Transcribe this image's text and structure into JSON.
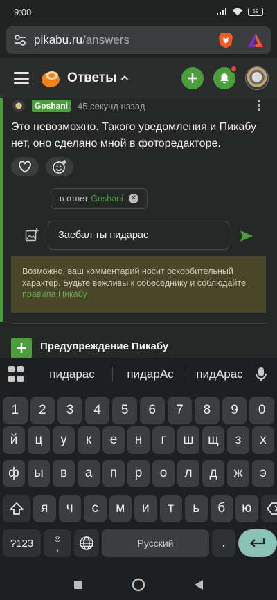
{
  "status_bar": {
    "time": "9:00",
    "battery": "59"
  },
  "browser": {
    "url_host": "pikabu.ru",
    "url_path": "/answers"
  },
  "app_header": {
    "title": "Ответы"
  },
  "comment": {
    "username": "Goshani",
    "time_ago": "45 секунд назад",
    "text": "Это невозможно. Такого уведомления и Пикабу нет, оно сделано мной в фоторедакторе."
  },
  "reply": {
    "reply_to_prefix": "в ответ",
    "reply_to_name": "Goshani",
    "input_value": "Заебал ты пидарас",
    "warning_text": "Возможно, ваш комментарий носит оскорбительный характер. Будьте вежливы к собеседнику и соблюдайте ",
    "warning_link": "правила Пикабу"
  },
  "section": {
    "title": "Предупреждение Пикабу"
  },
  "keyboard": {
    "suggestions": [
      "пидарас",
      "пидарАс",
      "пидАрас"
    ],
    "row_numbers": [
      "1",
      "2",
      "3",
      "4",
      "5",
      "6",
      "7",
      "8",
      "9",
      "0"
    ],
    "row1": [
      "й",
      "ц",
      "у",
      "к",
      "е",
      "н",
      "г",
      "ш",
      "щ",
      "з",
      "х"
    ],
    "row2": [
      "ф",
      "ы",
      "в",
      "а",
      "п",
      "р",
      "о",
      "л",
      "д",
      "ж",
      "э"
    ],
    "row3": [
      "я",
      "ч",
      "с",
      "м",
      "и",
      "т",
      "ь",
      "б",
      "ю"
    ],
    "symbols_key": "?123",
    "emoji_key": "☺",
    "comma_key": ",",
    "space_label": "Русский",
    "period_key": "."
  },
  "colors": {
    "accent_green": "#4c9e3c",
    "warning_bg": "#4a4629",
    "enter_key": "#8ac3b6"
  }
}
